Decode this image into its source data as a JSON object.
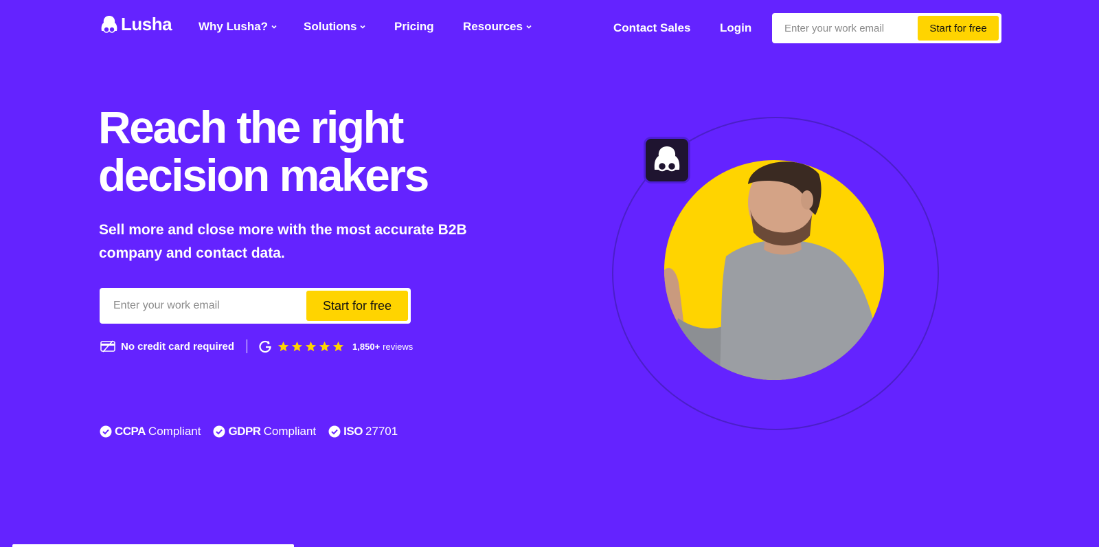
{
  "brand": {
    "name": "Lusha"
  },
  "nav": {
    "items": [
      {
        "label": "Why Lusha?",
        "has_dropdown": true
      },
      {
        "label": "Solutions",
        "has_dropdown": true
      },
      {
        "label": "Pricing",
        "has_dropdown": false
      },
      {
        "label": "Resources",
        "has_dropdown": true
      }
    ],
    "contact_sales": "Contact Sales",
    "login": "Login",
    "email_placeholder": "Enter your work email",
    "cta": "Start for free"
  },
  "hero": {
    "title_line1": "Reach the right",
    "title_line2": "decision makers",
    "subtitle_line1": "Sell more and close more with the most accurate B2B",
    "subtitle_line2": "company and contact data.",
    "email_placeholder": "Enter your work email",
    "cta": "Start for free"
  },
  "trust": {
    "no_credit_card": "No credit card required",
    "rating_stars": 5,
    "reviews_count": "1,850+",
    "reviews_label": "reviews"
  },
  "compliance": [
    {
      "strong": "CCPA",
      "light": "Compliant"
    },
    {
      "strong": "GDPR",
      "light": "Compliant"
    },
    {
      "strong": "ISO",
      "light": "27701"
    }
  ],
  "colors": {
    "background": "#6423ff",
    "accent": "#ffd400",
    "text": "#ffffff"
  }
}
